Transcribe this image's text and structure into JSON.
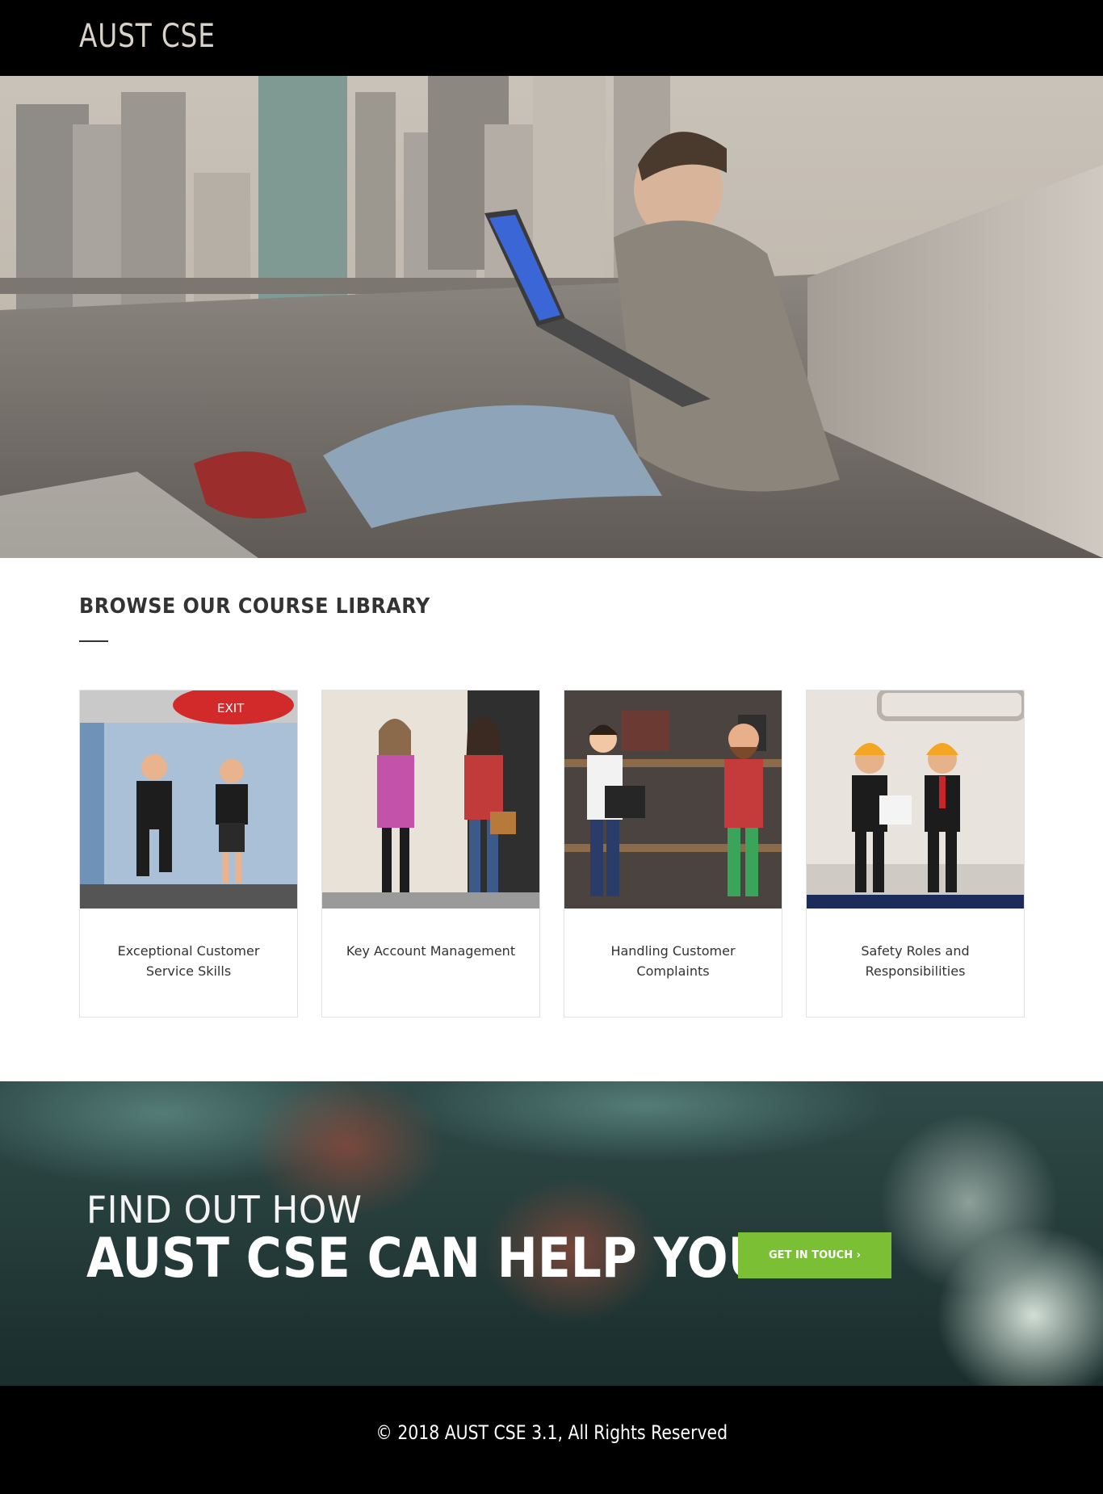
{
  "header": {
    "brand": "AUST CSE"
  },
  "hero": {
    "image": "student-with-laptop-city-road",
    "screen_color": "#3a66d6"
  },
  "library": {
    "title": "BROWSE OUR COURSE LIBRARY",
    "courses": [
      {
        "label": "Exceptional Customer Service Skills",
        "sign_text": "EXIT",
        "image": "people-running-to-exit"
      },
      {
        "label": "Key Account Management",
        "image": "two-women-talking"
      },
      {
        "label": "Handling Customer Complaints",
        "image": "men-in-bag-shop"
      },
      {
        "label": "Safety Roles and Responsibilities",
        "image": "engineers-with-hard-hats"
      }
    ]
  },
  "cta": {
    "line1": "FIND OUT HOW",
    "line2": "AUST CSE CAN HELP YOU",
    "button_label": "GET IN TOUCH ›",
    "button_color": "#7bbf34"
  },
  "footer": {
    "copyright": "© 2018 AUST CSE 3.1, All Rights Reserved"
  }
}
